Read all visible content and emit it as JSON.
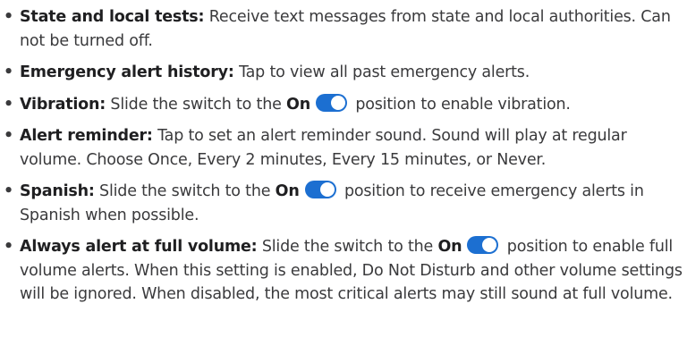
{
  "bullet": "•",
  "accent_color": "#1c6fd1",
  "toggle_state": "on",
  "items": [
    {
      "term": "State and local tests:",
      "body": "Receive text messages from state and local authorities. Can not be turned off."
    },
    {
      "term": "Emergency alert history:",
      "body": "Tap to view all past emergency alerts."
    },
    {
      "term": "Vibration:",
      "pre": "Slide the switch to the",
      "on": "On",
      "post": "position to enable vibration."
    },
    {
      "term": "Alert reminder:",
      "body": "Tap to set an alert reminder sound. Sound will play at regular volume. Choose Once, Every 2 minutes, Every 15 minutes, or Never."
    },
    {
      "term": "Spanish:",
      "pre": "Slide the switch to the",
      "on": "On",
      "post": "position to receive emergency alerts in Spanish when possible."
    },
    {
      "term": "Always alert at full volume:",
      "pre": "Slide the switch to the",
      "on": "On",
      "post": "position to enable full volume alerts. When this setting is enabled, Do Not Disturb and other volume settings will be ignored. When disabled, the most critical alerts may still sound at full volume."
    }
  ]
}
